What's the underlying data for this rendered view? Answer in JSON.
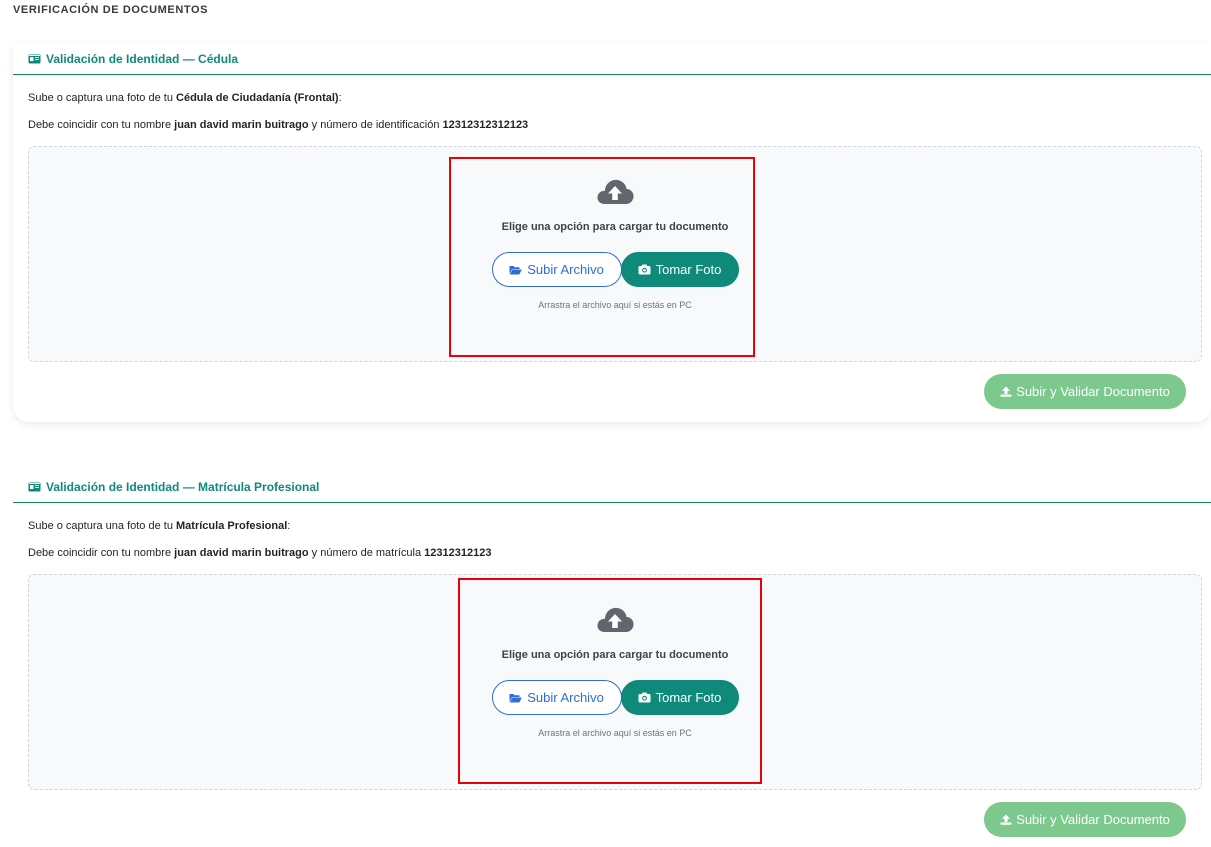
{
  "page": {
    "title": "VERIFICACIÓN DE DOCUMENTOS"
  },
  "colors": {
    "accent_teal": "#0f8a7a",
    "outline_blue": "#2f6ed4",
    "submit_green": "#7dc98d",
    "highlight_red": "#e8000b",
    "header_rule": "#198754"
  },
  "icons": {
    "header": "id-card-icon",
    "upload": "cloud-upload-icon",
    "file_button": "folder-open-icon",
    "photo_button": "camera-icon",
    "submit_button": "upload-icon"
  },
  "sections": [
    {
      "title": "Validación de Identidad — Cédula",
      "line1_prefix": "Sube o captura una foto de tu ",
      "line1_doc": "Cédula de Ciudadanía (Frontal)",
      "line1_suffix": ":",
      "line2_prefix": "Debe coincidir con tu nombre ",
      "name": "juan david marin buitrago",
      "line2_mid": " y número de identificación ",
      "number": "12312312312123",
      "prompt": "Elige una opción para cargar tu documento",
      "file_button": "Subir Archivo",
      "photo_button": "Tomar Foto",
      "hint": "Arrastra el archivo aquí si estás en PC",
      "submit_button": "Subir y Validar Documento"
    },
    {
      "title": "Validación de Identidad — Matrícula Profesional",
      "line1_prefix": "Sube o captura una foto de tu ",
      "line1_doc": "Matrícula Profesional",
      "line1_suffix": ":",
      "line2_prefix": "Debe coincidir con tu nombre ",
      "name": "juan david marin buitrago",
      "line2_mid": " y número de matrícula ",
      "number": "12312312123",
      "prompt": "Elige una opción para cargar tu documento",
      "file_button": "Subir Archivo",
      "photo_button": "Tomar Foto",
      "hint": "Arrastra el archivo aquí si estás en PC",
      "submit_button": "Subir y Validar Documento"
    }
  ]
}
